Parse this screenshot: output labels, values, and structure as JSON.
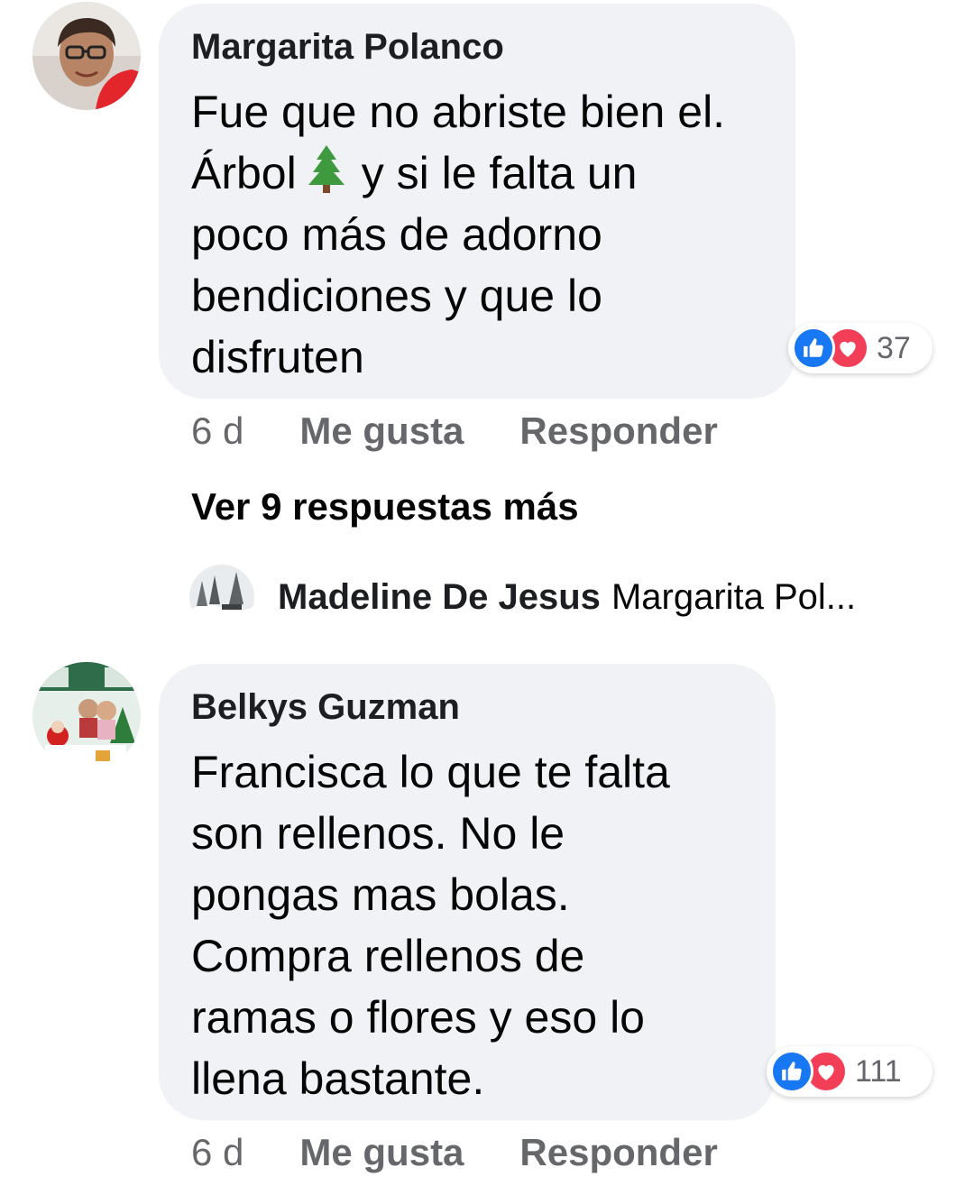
{
  "comments": [
    {
      "author": "Margarita Polanco",
      "line1": "Fue que no abriste bien el.",
      "line2_a": "Árbol",
      "line2_b": "y si le falta un",
      "line3": "poco más de adorno",
      "line4": "bendiciones y que lo",
      "line5": "disfruten",
      "emoji_icon": "christmas-tree-icon",
      "reaction_count": "37",
      "time": "6 d",
      "like_label": "Me gusta",
      "reply_label": "Responder"
    },
    {
      "author": "Belkys Guzman",
      "lines": [
        "Francisca lo que te falta",
        "son rellenos. No le",
        "pongas mas bolas.",
        "Compra rellenos de",
        "ramas o flores y eso lo",
        "llena bastante."
      ],
      "reaction_count": "111",
      "time": "6 d",
      "like_label": "Me gusta",
      "reply_label": "Responder"
    }
  ],
  "view_more": "Ver 9 respuestas más",
  "reply_preview": {
    "author": "Madeline De Jesus",
    "text": "Margarita Pol..."
  },
  "colors": {
    "bubble": "#f0f2f5",
    "like_blue": "#1877f2",
    "love_red": "#f33e58",
    "meta_gray": "#65676b"
  }
}
